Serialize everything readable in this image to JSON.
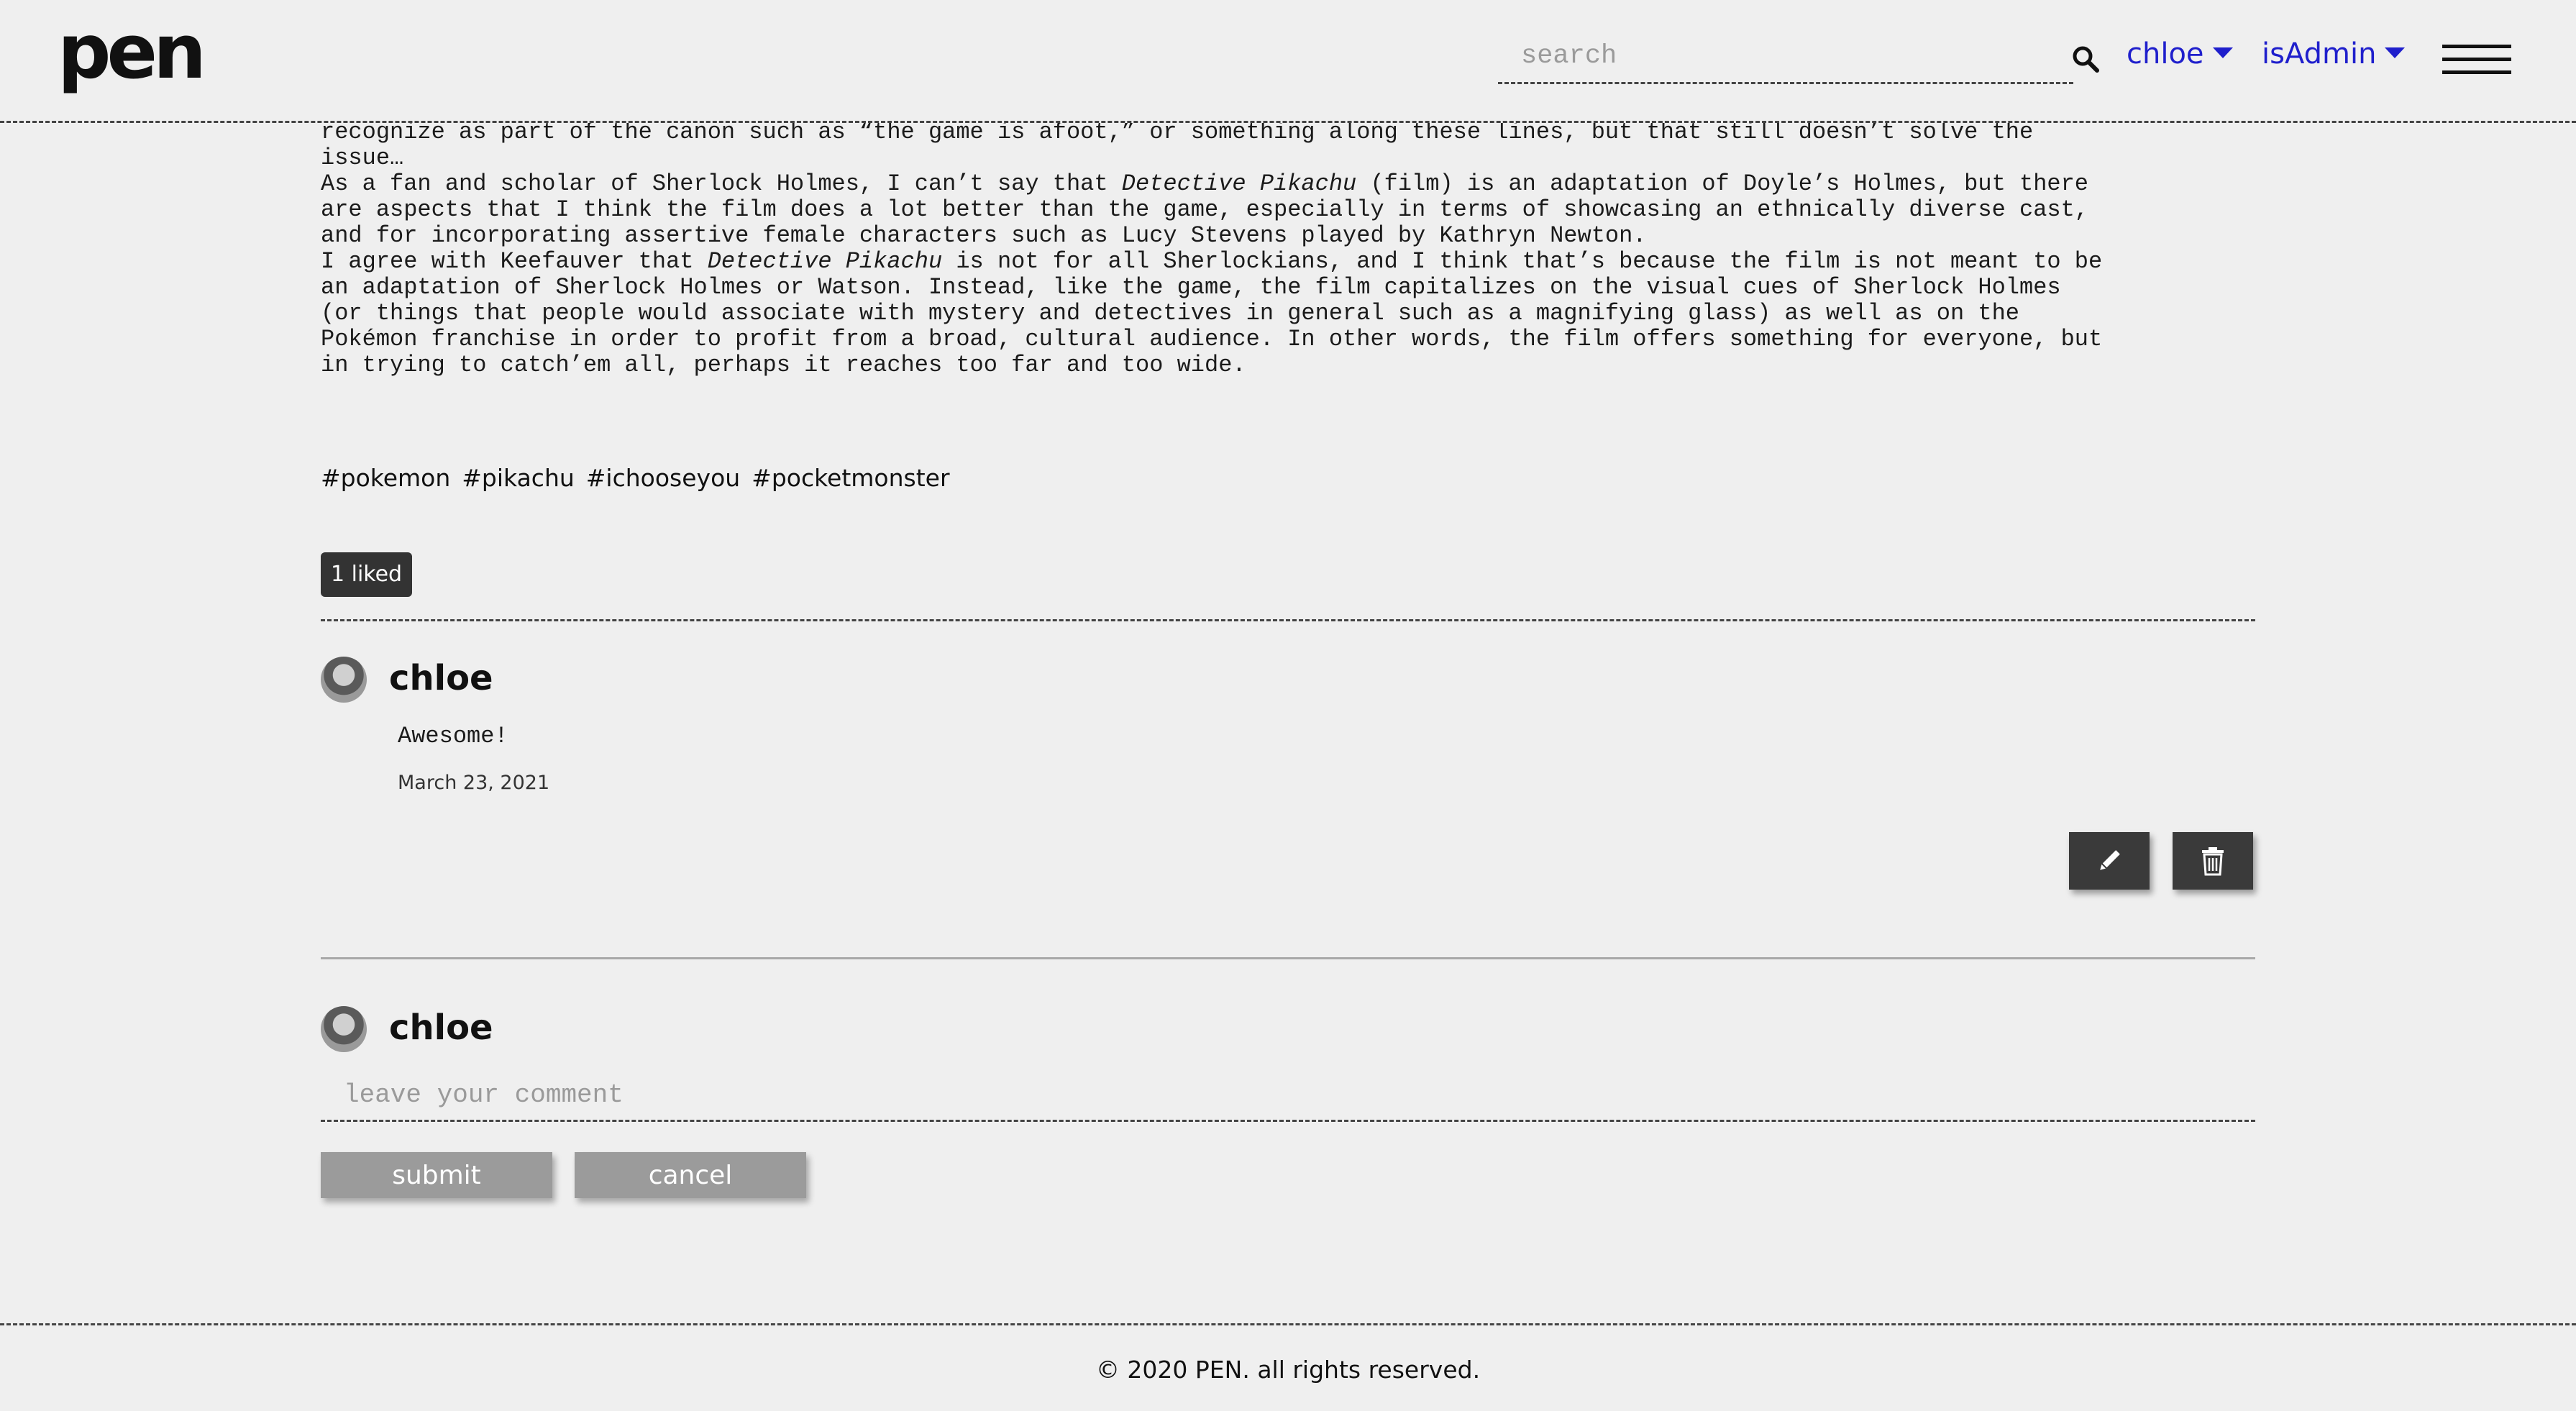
{
  "header": {
    "logo": "pen",
    "search_placeholder": "search",
    "user_menu": "chloe",
    "role_menu": "isAdmin"
  },
  "article": {
    "paragraphs": [
      "recognize as part of the canon such as “the game is afoot,” or something along these lines, but that still doesn’t solve the\nissue…",
      "As a fan and scholar of Sherlock Holmes, I can’t say that |Detective Pikachu| (film) is an adaptation of Doyle’s Holmes, but there\nare aspects that I think the film does a lot better than the game, especially in terms of showcasing an ethnically diverse cast,\nand for incorporating assertive female characters such as Lucy Stevens played by Kathryn Newton.",
      "I agree with Keefauver that |Detective Pikachu| is not for all Sherlockians, and I think that’s because the film is not meant to be\nan adaptation of Sherlock Holmes or Watson. Instead, like the game, the film capitalizes on the visual cues of Sherlock Holmes\n(or things that people would associate with mystery and detectives in general such as a magnifying glass) as well as on the\nPokémon franchise in order to profit from a broad, cultural audience. In other words, the film offers something for everyone, but\nin trying to catch’em all, perhaps it reaches too far and too wide."
    ],
    "tags": [
      "#pokemon",
      "#pikachu",
      "#ichooseyou",
      "#pocketmonster"
    ],
    "liked_label": "1 liked"
  },
  "comments": [
    {
      "user": "chloe",
      "text": "Awesome!",
      "date": "March 23, 2021"
    }
  ],
  "new_comment": {
    "user": "chloe",
    "placeholder": "leave your comment",
    "submit_label": "submit",
    "cancel_label": "cancel"
  },
  "footer": {
    "copyright": "© 2020 PEN. all rights reserved."
  },
  "icons": {
    "search": "search-icon",
    "edit": "pencil-icon",
    "delete": "trash-icon",
    "menu": "hamburger-icon",
    "dropdown": "caret-down-icon"
  },
  "colors": {
    "accent": "#1f1fcc",
    "background": "#efefef",
    "dark_button": "#3a3a3a",
    "form_button": "#9b9b9b"
  }
}
